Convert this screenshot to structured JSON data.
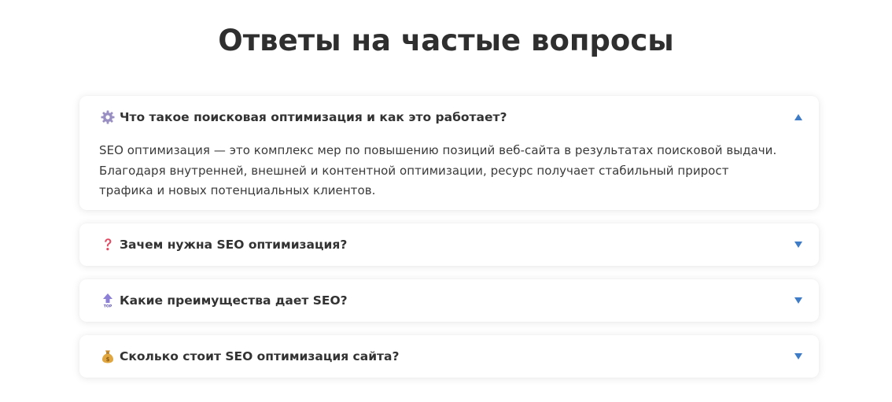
{
  "page": {
    "title": "Ответы на частые вопросы"
  },
  "colors": {
    "accent": "#3f7cc8",
    "title": "#2f2f2f",
    "text": "#333333"
  },
  "faq": {
    "items": [
      {
        "icon": "gear-icon",
        "question": "Что такое поисковая оптимизация и как это работает?",
        "expanded": true,
        "answer_lines": [
          "SEO оптимизация — это комплекс мер по повышению позиций веб-сайта в результатах поисковой выдачи.",
          "Благодаря внутренней, внешней и контентной оптимизации, ресурс получает стабильный прирост",
          "трафика и новых потенциальных клиентов."
        ]
      },
      {
        "icon": "question-mark-icon",
        "question": "Зачем нужна SEO оптимизация?",
        "expanded": false
      },
      {
        "icon": "top-arrow-icon",
        "question": "Какие преимущества дает SEO?",
        "expanded": false
      },
      {
        "icon": "money-bag-icon",
        "question": "Сколько стоит SEO оптимизация сайта?",
        "expanded": false
      }
    ]
  }
}
